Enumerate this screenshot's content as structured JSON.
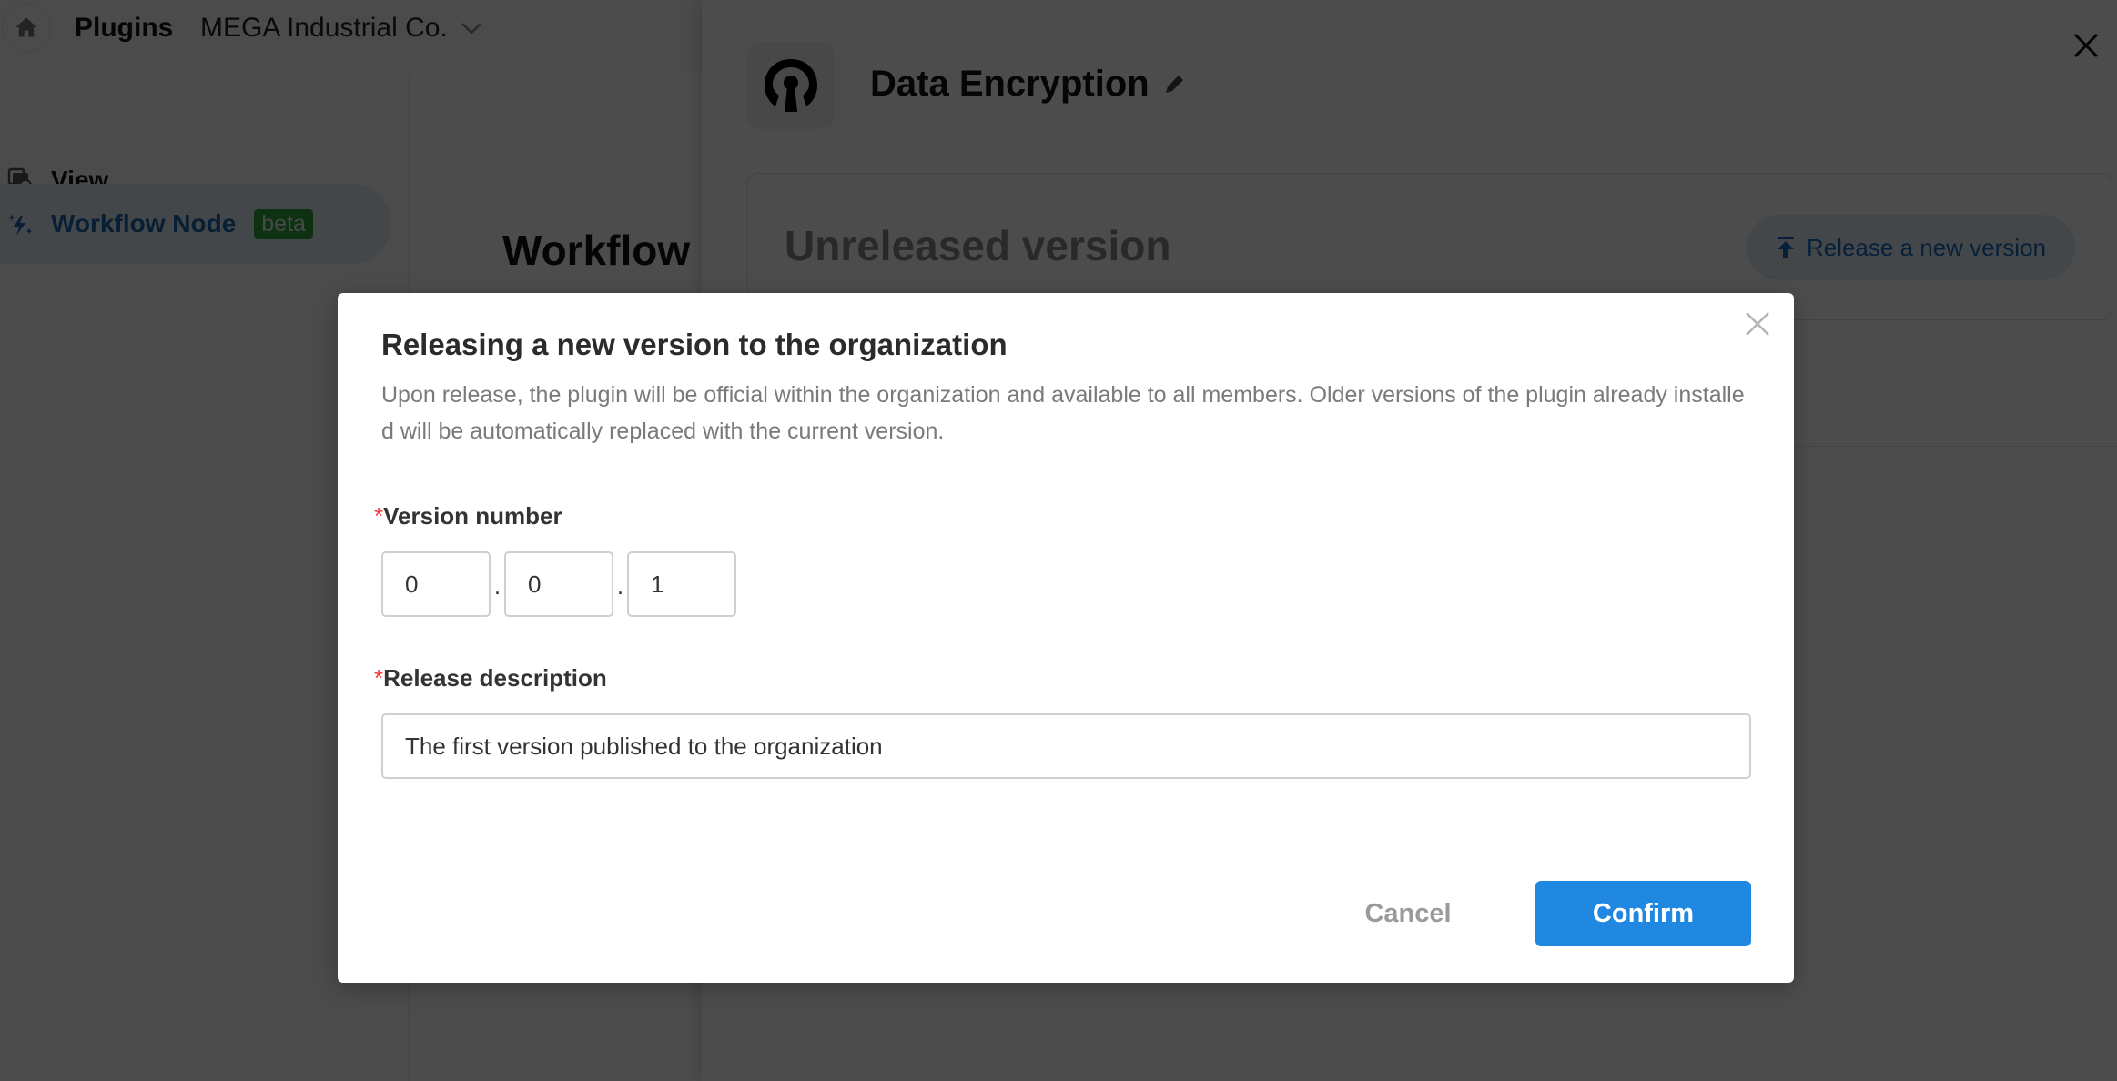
{
  "topbar": {
    "home_icon": "home-icon",
    "title": "Plugins",
    "organization": "MEGA Industrial Co.",
    "org_dropdown_icon": "chevron-down-icon"
  },
  "sidebar": {
    "items": [
      {
        "label": "View",
        "icon": "view-icon",
        "active": false
      },
      {
        "label": "Workflow Node",
        "icon": "sparkle-lightning-icon",
        "badge": "beta",
        "active": true
      }
    ]
  },
  "main": {
    "heading": "Workflow"
  },
  "drawer": {
    "plugin_icon": "keyhole-icon",
    "plugin_name": "Data Encryption",
    "edit_icon": "pencil-icon",
    "close_icon": "close-icon",
    "version_card": {
      "title": "Unreleased version",
      "release_button": "Release a new version",
      "release_icon": "upload-icon"
    }
  },
  "modal": {
    "title": "Releasing a new version to the organization",
    "description": "Upon release, the plugin will be official within the organization and available to all members. Older versions of the plugin already installed will be automatically replaced with the current version.",
    "close_icon": "close-icon",
    "version_label": "Version number",
    "required_mark": "*",
    "version": {
      "major": "0",
      "minor": "0",
      "patch": "1",
      "separator": "."
    },
    "description_label": "Release description",
    "release_description_value": "The first version published to the organization",
    "cancel_label": "Cancel",
    "confirm_label": "Confirm"
  },
  "colors": {
    "primary": "#2188e2",
    "active_text": "#1867b0",
    "required": "#ef3b3b",
    "badge": "#2ea33a"
  }
}
